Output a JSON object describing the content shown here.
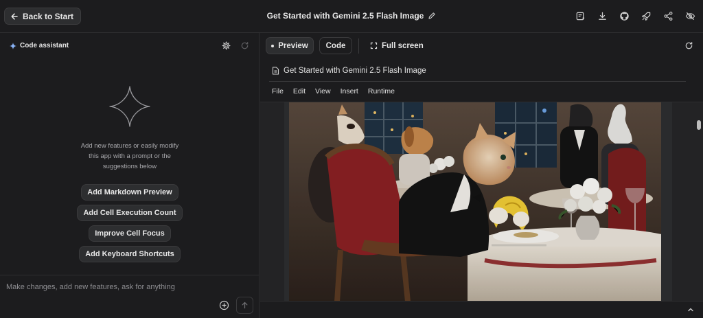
{
  "topbar": {
    "back_label": "Back to Start",
    "title": "Get Started with Gemini 2.5 Flash Image",
    "actions": [
      "notebook-export-icon",
      "download-icon",
      "github-icon",
      "rocket-icon",
      "share-icon",
      "eye-off-icon"
    ]
  },
  "assistant": {
    "header": "Code assistant",
    "intro_lines": [
      "Add new features or easily modify",
      "this app with a prompt or the",
      "suggestions below"
    ],
    "suggestions": [
      "Add Markdown Preview",
      "Add Cell Execution Count",
      "Improve Cell Focus",
      "Add Keyboard Shortcuts"
    ],
    "prompt_placeholder": "Make changes, add new features, ask for anything"
  },
  "preview": {
    "tabs": {
      "preview": "Preview",
      "code": "Code",
      "fullscreen": "Full screen"
    },
    "notebook_title": "Get Started with Gemini 2.5 Flash Image",
    "menu": [
      "File",
      "Edit",
      "View",
      "Insert",
      "Runtime"
    ]
  },
  "colors": {
    "bg": "#1c1c1e",
    "button": "#2d2e30",
    "accent_star": "#8ab4f8"
  }
}
